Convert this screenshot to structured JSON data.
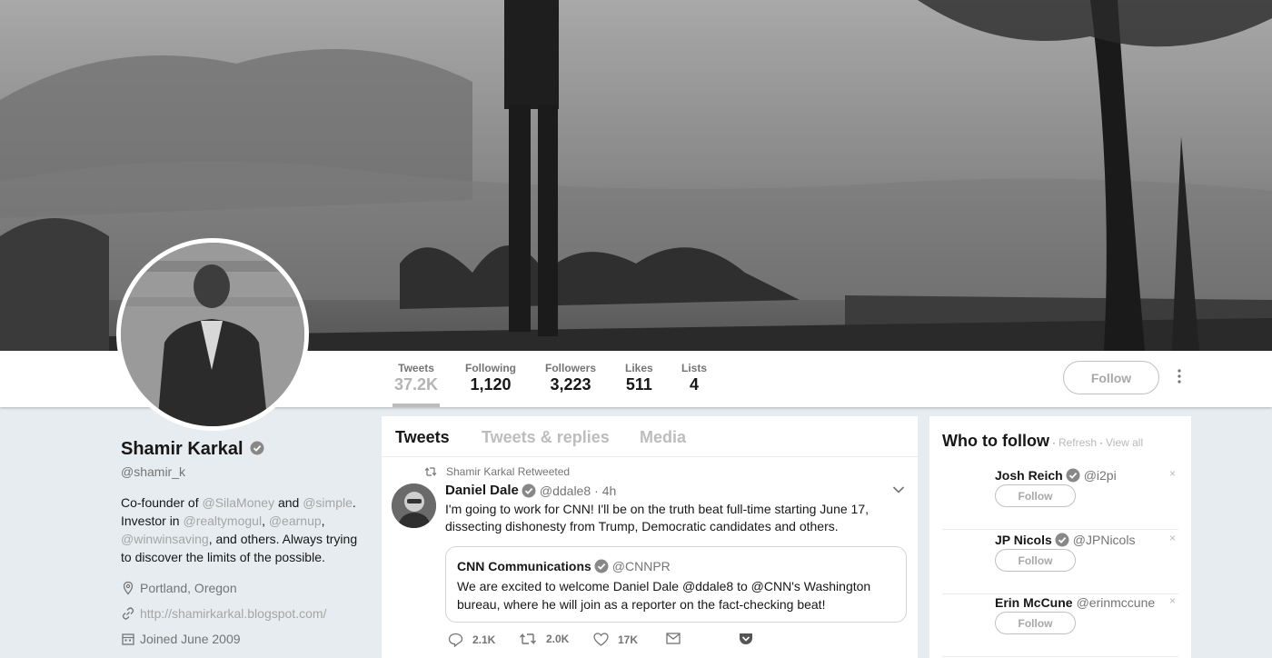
{
  "profile": {
    "name": "Shamir Karkal",
    "handle": "@shamir_k",
    "bio": {
      "t1": "Co-founder of ",
      "l1": "@SilaMoney",
      "t2": " and ",
      "l2": "@simple",
      "t3": ". Investor in ",
      "l3": "@realtymogul",
      "t4": ", ",
      "l4": "@earnup",
      "t5": ", ",
      "l5": "@winwinsaving",
      "t6": ", and others. Always trying to discover the limits of the possible."
    },
    "location": "Portland, Oregon",
    "website": "http://shamirkarkal.blogspot.com/",
    "joined": "Joined June 2009"
  },
  "stats": [
    {
      "label": "Tweets",
      "value": "37.2K"
    },
    {
      "label": "Following",
      "value": "1,120"
    },
    {
      "label": "Followers",
      "value": "3,223"
    },
    {
      "label": "Likes",
      "value": "511"
    },
    {
      "label": "Lists",
      "value": "4"
    }
  ],
  "follow_label": "Follow",
  "tabs": [
    "Tweets",
    "Tweets & replies",
    "Media"
  ],
  "tweet": {
    "context": "Shamir Karkal Retweeted",
    "author": "Daniel Dale",
    "handle": "@ddale8",
    "time": "· 4h",
    "text": "I'm going to work for CNN! I'll be on the truth beat full-time starting June 17, dissecting dishonesty from Trump, Democratic candidates and others.",
    "quote": {
      "author": "CNN Communications",
      "handle": "@CNNPR",
      "text": "We are excited to welcome Daniel Dale @ddale8 to @CNN's Washington bureau, where he will join as a reporter on the fact-checking beat!"
    },
    "actions": {
      "replies": "2.1K",
      "retweets": "2.0K",
      "likes": "17K"
    }
  },
  "who_to_follow": {
    "title": "Who to follow",
    "refresh": "Refresh",
    "view_all": "View all",
    "dot": "·",
    "follow_label": "Follow",
    "close": "×",
    "items": [
      {
        "name": "Josh Reich",
        "handle": "@i2pi"
      },
      {
        "name": "JP Nicols",
        "handle": "@JPNicols"
      },
      {
        "name": "Erin McCune",
        "handle": "@erinmccune"
      }
    ]
  },
  "colors": {
    "accent_gray": "#a0a9b1",
    "link_gray": "#9aa7b2",
    "text_primary": "#14171a",
    "text_secondary": "#657786"
  },
  "icons": [
    "verified-badge-icon",
    "location-pin-icon",
    "link-icon",
    "calendar-icon",
    "retweet-icon",
    "reply-icon",
    "heart-icon",
    "mail-icon",
    "pocket-icon",
    "chevron-down-icon",
    "more-vertical-icon"
  ]
}
